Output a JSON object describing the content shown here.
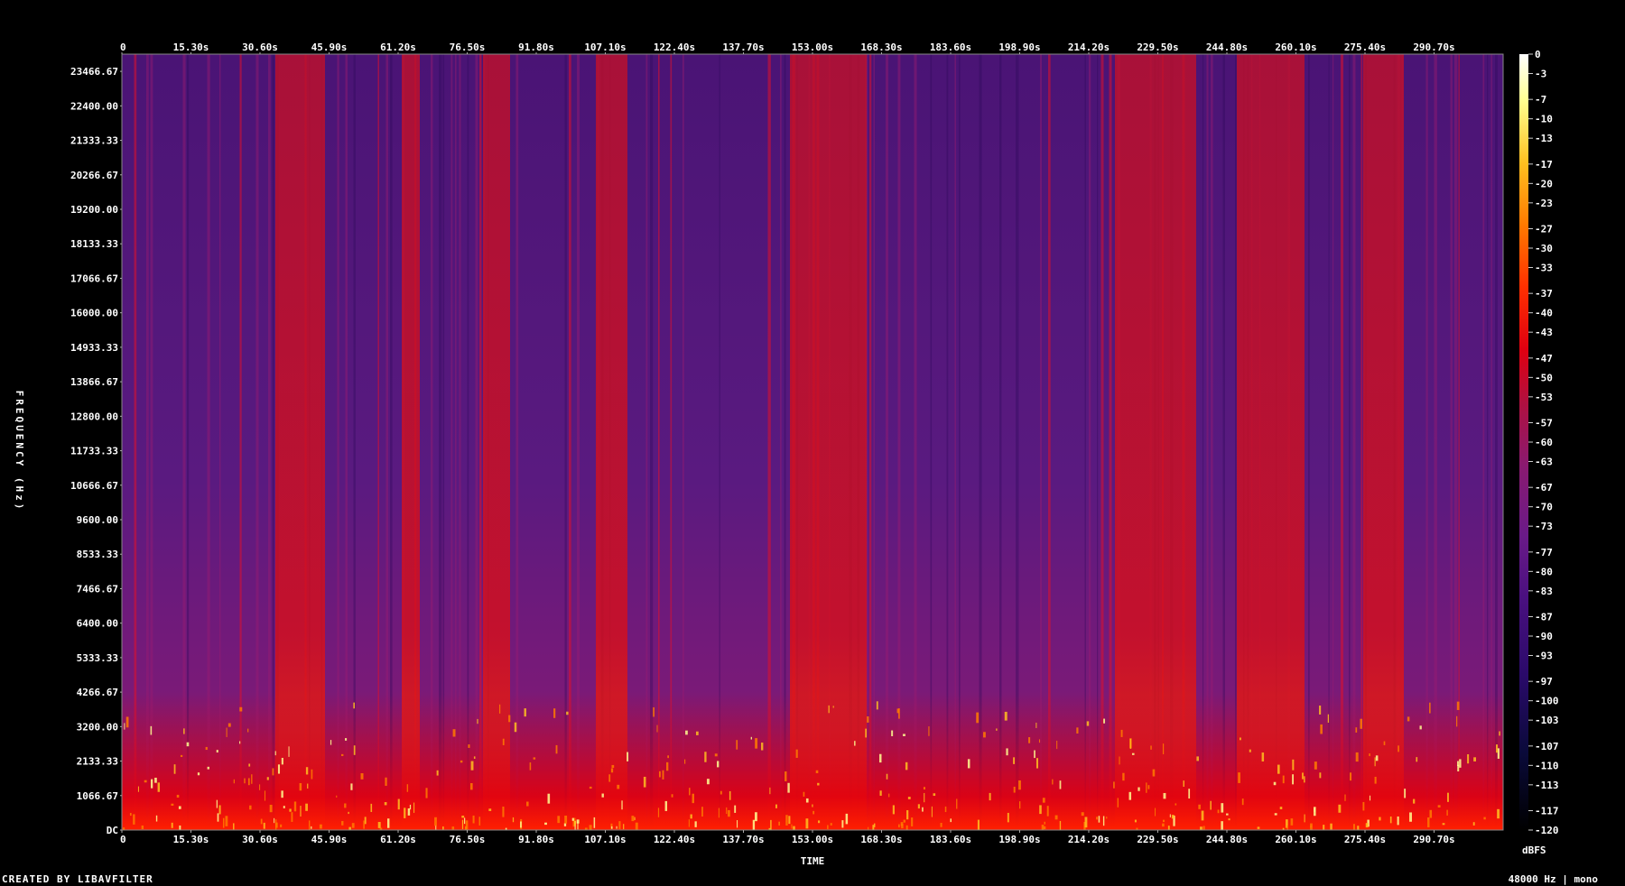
{
  "chart_data": {
    "type": "heatmap",
    "title": "",
    "xlabel": "TIME",
    "ylabel": "FREQUENCY (Hz)",
    "x_ticks": [
      "0",
      "15.30s",
      "30.60s",
      "45.90s",
      "61.20s",
      "76.50s",
      "91.80s",
      "107.10s",
      "122.40s",
      "137.70s",
      "153.00s",
      "168.30s",
      "183.60s",
      "198.90s",
      "214.20s",
      "229.50s",
      "244.80s",
      "260.10s",
      "275.40s",
      "290.70s"
    ],
    "x_tick_values": [
      0,
      15.3,
      30.6,
      45.9,
      61.2,
      76.5,
      91.8,
      107.1,
      122.4,
      137.7,
      153.0,
      168.3,
      183.6,
      198.9,
      214.2,
      229.5,
      244.8,
      260.1,
      275.4,
      290.7
    ],
    "xlim": [
      0,
      306
    ],
    "y_ticks": [
      "DC",
      "1066.67",
      "2133.33",
      "3200.00",
      "4266.67",
      "5333.33",
      "6400.00",
      "7466.67",
      "8533.33",
      "9600.00",
      "10666.67",
      "11733.33",
      "12800.00",
      "13866.67",
      "14933.33",
      "16000.00",
      "17066.67",
      "18133.33",
      "19200.00",
      "20266.67",
      "21333.33",
      "22400.00",
      "23466.67"
    ],
    "y_tick_values": [
      0,
      1066.67,
      2133.33,
      3200,
      4266.67,
      5333.33,
      6400,
      7466.67,
      8533.33,
      9600,
      10666.67,
      11733.33,
      12800,
      13866.67,
      14933.33,
      16000,
      17066.67,
      18133.33,
      19200,
      20266.67,
      21333.33,
      22400,
      23466.67
    ],
    "ylim": [
      0,
      24000
    ],
    "colorbar_label": "dBFS",
    "colorbar_ticks": [
      "0",
      "-3",
      "-7",
      "-10",
      "-13",
      "-17",
      "-20",
      "-23",
      "-27",
      "-30",
      "-33",
      "-37",
      "-40",
      "-43",
      "-47",
      "-50",
      "-53",
      "-57",
      "-60",
      "-63",
      "-67",
      "-70",
      "-73",
      "-77",
      "-80",
      "-83",
      "-87",
      "-90",
      "-93",
      "-97",
      "-100",
      "-103",
      "-107",
      "-110",
      "-113",
      "-117",
      "-120"
    ],
    "colorbar_range": [
      -120,
      0
    ],
    "colormap": [
      "#000000",
      "#0a0a3a",
      "#2a0a6a",
      "#4a1080",
      "#6a1a88",
      "#8a1a70",
      "#b01040",
      "#e00010",
      "#ff3000",
      "#ff7a00",
      "#ffc020",
      "#ffff90",
      "#ffffff"
    ],
    "loud_segments_s": [
      [
        34,
        45
      ],
      [
        62,
        66
      ],
      [
        80,
        86
      ],
      [
        105,
        112
      ],
      [
        148,
        165
      ],
      [
        220,
        238
      ],
      [
        247,
        262
      ],
      [
        275,
        284
      ]
    ]
  },
  "footer": {
    "left": "CREATED BY LIBAVFILTER",
    "right": "48000 Hz | mono"
  }
}
